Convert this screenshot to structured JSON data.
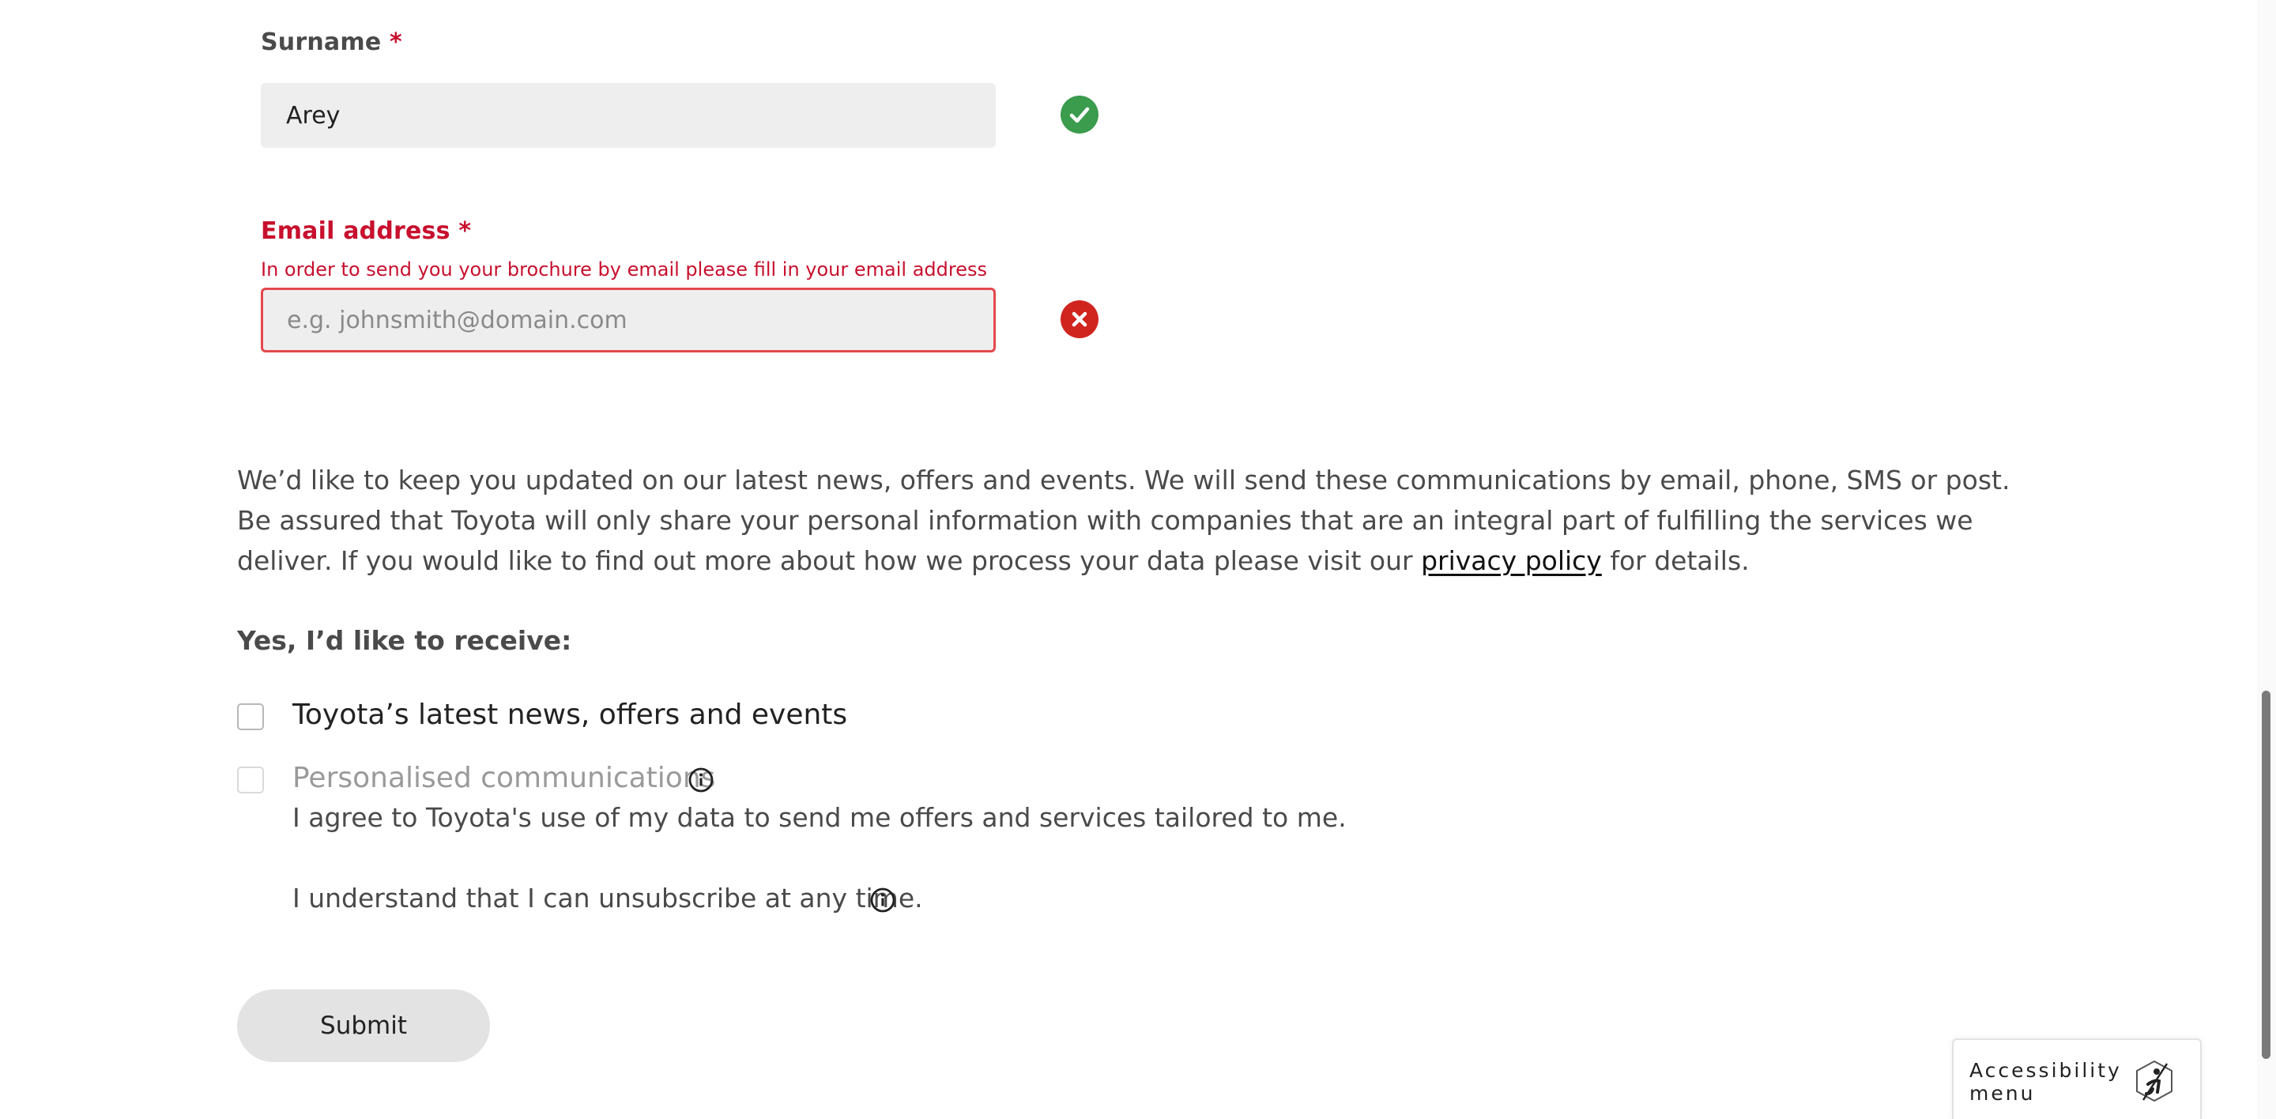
{
  "surname": {
    "label": "Surname",
    "required_mark": "*",
    "value": "Arey",
    "status_icon": "check-icon"
  },
  "email": {
    "label": "Email address",
    "required_mark": "*",
    "error_message": "In order to send you your brochure by email please fill in your email address",
    "value": "",
    "placeholder": "e.g. johnsmith@domain.com",
    "status_icon": "error-x-icon"
  },
  "consent": {
    "text_before_link": "We’d like to keep you updated on our latest news, offers and events. We will send these communications by email, phone, SMS or post. Be assured that Toyota will only share your personal information with companies that are an integral part of fulfilling the services we deliver. If you would like to find out more about how we process your data please visit our ",
    "link_text": "privacy policy",
    "text_after_link": " for details."
  },
  "receive": {
    "heading": "Yes, I’d like to receive:",
    "option_news": "Toyota’s latest news, offers and events",
    "option_personalised": "Personalised communications",
    "personalised_note": "I agree to Toyota's use of my data to send me offers and services tailored to me.",
    "unsubscribe_note": "I understand that I can unsubscribe at any time."
  },
  "submit_label": "Submit",
  "accessibility": {
    "label": "Accessibility menu",
    "icon": "accessibility-icon"
  },
  "colors": {
    "error": "#c8102e",
    "success": "#3a9c4c",
    "field_bg": "#eeeeee"
  }
}
